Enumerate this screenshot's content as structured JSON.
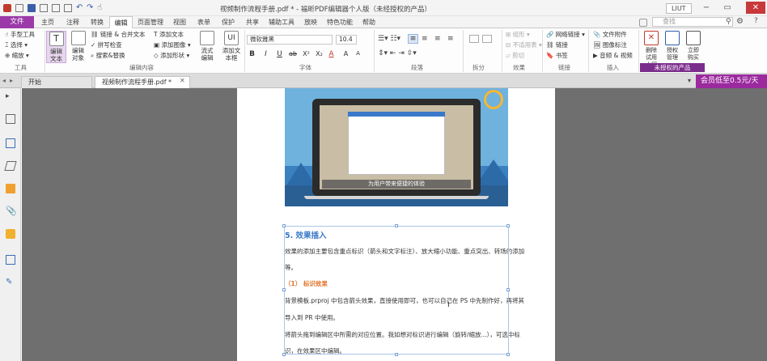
{
  "window": {
    "title": "视频制作流程手册.pdf * - 福昕PDF编辑器个人版（未经授权的产品）",
    "user_label": "LIUT"
  },
  "menu": {
    "file_label": "文件",
    "tabs": [
      "主页",
      "注释",
      "转换",
      "编辑",
      "页面管理",
      "视图",
      "表单",
      "保护",
      "共享",
      "辅助工具",
      "放映",
      "特色功能",
      "帮助"
    ],
    "active_tab": "编辑",
    "search_placeholder": "查找"
  },
  "ribbon": {
    "tools": {
      "hand": "手型工具",
      "select": "选择",
      "zoom": "缩放",
      "group": "工具"
    },
    "edit_content": {
      "edit_text": "编辑文本",
      "edit_object": "编辑对象",
      "link_merge": "链接 & 合并文本",
      "spell_check": "拼写检查",
      "find_replace": "搜索&替换",
      "add_text": "添加文本",
      "add_image": "添加图像",
      "add_shape": "添加形状",
      "flow_edit": "流式编辑",
      "add_textbox": "添加文本框",
      "group": "编辑内容"
    },
    "font": {
      "name": "微软雅黑",
      "size": "10.4",
      "group": "字体",
      "buttons": [
        "B",
        "I",
        "U",
        "ab",
        "X²",
        "X₂",
        "A",
        "A",
        "A"
      ]
    },
    "paragraph": {
      "group": "段落"
    },
    "split": {
      "group": "拆分"
    },
    "effects": {
      "merge": "组形",
      "no_wrap": "不适用表",
      "shear": "剪切",
      "group": "效果"
    },
    "links": {
      "web_link": "网络链接",
      "link": "链接",
      "bookmark": "书签",
      "group": "链接"
    },
    "insert": {
      "file_attachment": "文件附件",
      "image_annotation": "图像标注",
      "audio_video": "音频 & 视频",
      "group": "插入"
    },
    "trial": {
      "delete_trial": "删除试用水印",
      "authorize": "授权管理",
      "buy_now": "立即购买",
      "unauthorized": "未授权的产品"
    }
  },
  "doc_tabs": {
    "start": "开始",
    "document": "视频制作流程手册.pdf *",
    "member_banner": "会员低至0.5元/天"
  },
  "page": {
    "hero_caption": "为用户带来便捷的体验",
    "heading": "5. 效果插入",
    "para1_line1": "效果的添加主要包含重点标识（箭头和文字标注）、放大缩小功能、重点突出、转场的添加",
    "para1_line2": "等。",
    "sub_heading": "（1） 标识效果",
    "para2_line1": "背景模板.prproj 中包含箭头效果，直接使用即可，也可以自己在 PS 中先制作好，再将其",
    "para2_line2": "导入到 PR 中使用。",
    "para3_line1": "将箭头拖到编辑区中所需的对应位置。我如想对标识进行编辑（旋转/缩放...），可选中标",
    "para3_line2": "识，在效果区中编辑。"
  },
  "colors": {
    "accent": "#9b3aa8",
    "heading_blue": "#3a78c9",
    "subheading_orange": "#e2742b",
    "canvas": "#6f6f6f"
  }
}
